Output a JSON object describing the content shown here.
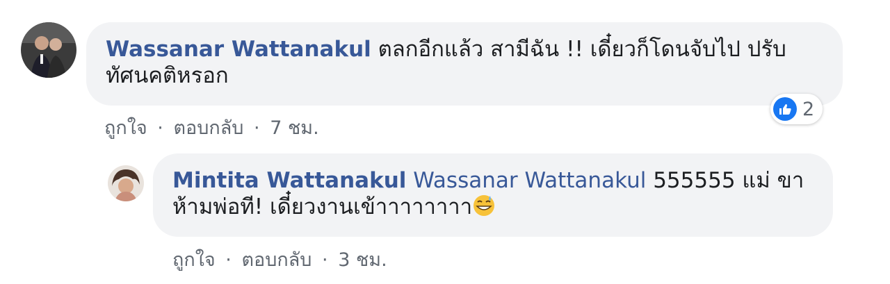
{
  "comments": [
    {
      "author": "Wassanar Wattanakul",
      "text": "ตลกอีกแล้ว สามีฉัน !! เดี๋ยวก็โดนจับไป ปรับทัศนคติหรอก",
      "actions": {
        "like": "ถูกใจ",
        "reply": "ตอบกลับ",
        "time": "7 ชม.",
        "separator": "·"
      },
      "reaction": {
        "icon": "like-icon",
        "count": "2"
      }
    },
    {
      "author": "Mintita Wattanakul",
      "mention": "Wassanar Wattanakul",
      "text": " 555555 แม่ ขา ห้ามพ่อที! เดี๋ยวงานเข้าาาาาาาา",
      "emoji": "grinning-sweat-emoji",
      "actions": {
        "like": "ถูกใจ",
        "reply": "ตอบกลับ",
        "time": "3 ชม.",
        "separator": "·"
      }
    }
  ],
  "colors": {
    "link": "#385898",
    "bubble": "#f2f3f5",
    "meta": "#606770",
    "like_blue": "#1877f2"
  }
}
